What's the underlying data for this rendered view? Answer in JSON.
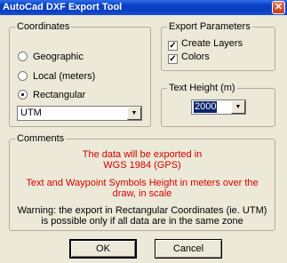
{
  "window": {
    "title": "AutoCad DXF Export Tool",
    "close_glyph": "✕"
  },
  "coordinates": {
    "title": "Coordinates",
    "options": [
      {
        "label": "Geographic",
        "checked": false
      },
      {
        "label": "Local (meters)",
        "checked": false
      },
      {
        "label": "Rectangular",
        "checked": true
      }
    ],
    "system_value": "UTM"
  },
  "export_parameters": {
    "title": "Export Parameters",
    "create_layers_label": "Create Layers",
    "create_layers_checked": true,
    "colors_label": "Colors",
    "colors_checked": true
  },
  "text_height": {
    "title": "Text Height (m)",
    "value": "2000"
  },
  "comments": {
    "title": "Comments",
    "line1": "The data will be exported in",
    "line2": "WGS 1984 (GPS)",
    "line3": "Text and Waypoint Symbols Height in meters over the",
    "line4": "draw, in scale",
    "line5": "Warning: the export in Rectangular Coordinates (ie. UTM)",
    "line6": "is possible only if all data are in the same zone"
  },
  "buttons": {
    "ok": "OK",
    "cancel": "Cancel"
  },
  "glyphs": {
    "check": "✓",
    "dropdown_arrow": "▼"
  },
  "colors": {
    "title_bar": "#0a3fc4",
    "comment_red": "#d40000",
    "selection": "#0a246a"
  }
}
